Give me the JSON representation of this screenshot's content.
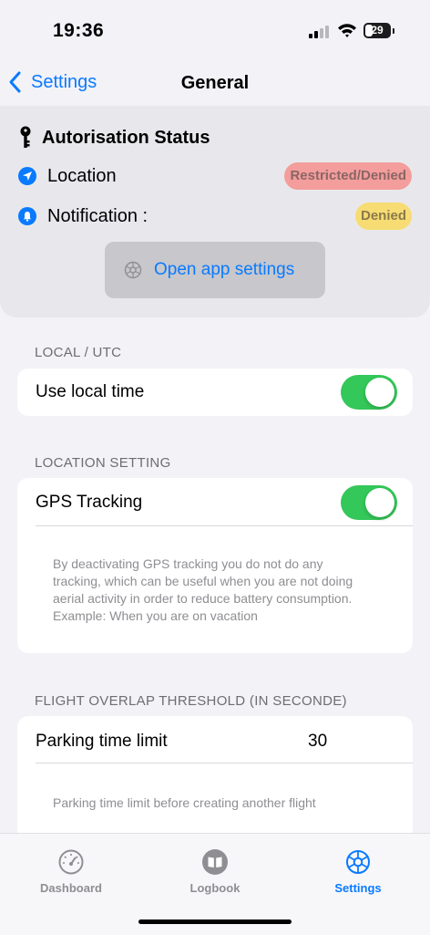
{
  "status_bar": {
    "time": "19:36",
    "battery": "29"
  },
  "nav": {
    "back_label": "Settings",
    "title": "General"
  },
  "authorisation": {
    "title": "Autorisation Status",
    "location_label": "Location",
    "location_status": "Restricted/Denied",
    "notification_label": "Notification :",
    "notification_status": "Denied",
    "open_settings_label": "Open app settings"
  },
  "sections": {
    "local_utc": {
      "header": "LOCAL / UTC",
      "label": "Use local time",
      "enabled": true
    },
    "location": {
      "header": "LOCATION SETTING",
      "label": "GPS Tracking",
      "enabled": true,
      "footnote": "By deactivating GPS tracking you do not do any tracking, which can be useful when you are not doing aerial activity in order to reduce battery consumption. Example: When you are on vacation"
    },
    "overlap": {
      "header": "FLIGHT OVERLAP THRESHOLD (IN SECONDE)",
      "label": "Parking time limit",
      "value": "30",
      "footnote": "Parking time limit before creating another flight"
    }
  },
  "tabs": [
    {
      "label": "Dashboard",
      "icon": "speedometer-icon",
      "active": false
    },
    {
      "label": "Logbook",
      "icon": "book-icon",
      "active": false
    },
    {
      "label": "Settings",
      "icon": "gear-icon",
      "active": true
    }
  ],
  "colors": {
    "accent": "#0a7aff",
    "toggle_on": "#34c759",
    "restricted": "#f39e9c",
    "denied": "#f7dc74"
  }
}
